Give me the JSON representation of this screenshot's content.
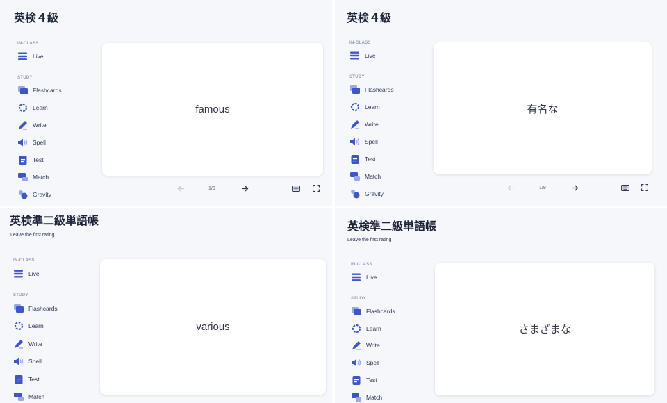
{
  "panels": [
    {
      "title": "英検４級",
      "rating": "",
      "sections": {
        "in_class": "IN-CLASS",
        "study": "STUDY"
      },
      "nav": [
        "Live",
        "Flashcards",
        "Learn",
        "Write",
        "Spell",
        "Test",
        "Match",
        "Gravity"
      ],
      "card_text": "famous",
      "counter": "1/9"
    },
    {
      "title": "英検４級",
      "rating": "",
      "sections": {
        "in_class": "IN-CLASS",
        "study": "STUDY"
      },
      "nav": [
        "Live",
        "Flashcards",
        "Learn",
        "Write",
        "Spell",
        "Test",
        "Match",
        "Gravity"
      ],
      "card_text": "有名な",
      "counter": "1/9"
    },
    {
      "title": "英検準二級単語帳",
      "rating": "Leave the first rating",
      "sections": {
        "in_class": "IN-CLASS",
        "study": "STUDY"
      },
      "nav": [
        "Live",
        "Flashcards",
        "Learn",
        "Write",
        "Spell",
        "Test",
        "Match"
      ],
      "card_text": "various",
      "counter": ""
    },
    {
      "title": "英検準二級単語帳",
      "rating": "Leave the first rating",
      "sections": {
        "in_class": "IN-CLASS",
        "study": "STUDY"
      },
      "nav": [
        "Live",
        "Flashcards",
        "Learn",
        "Write",
        "Spell",
        "Test",
        "Match"
      ],
      "card_text": "さまざまな",
      "counter": ""
    }
  ],
  "icons": [
    "live-icon",
    "flashcards-icon",
    "learn-icon",
    "write-icon",
    "spell-icon",
    "test-icon",
    "match-icon",
    "gravity-icon"
  ],
  "colors": {
    "accent": "#4255ff",
    "icon_blue": "#3f57c6",
    "icon_light": "#98a8f0",
    "background": "#f6f7fb",
    "card": "#ffffff"
  }
}
